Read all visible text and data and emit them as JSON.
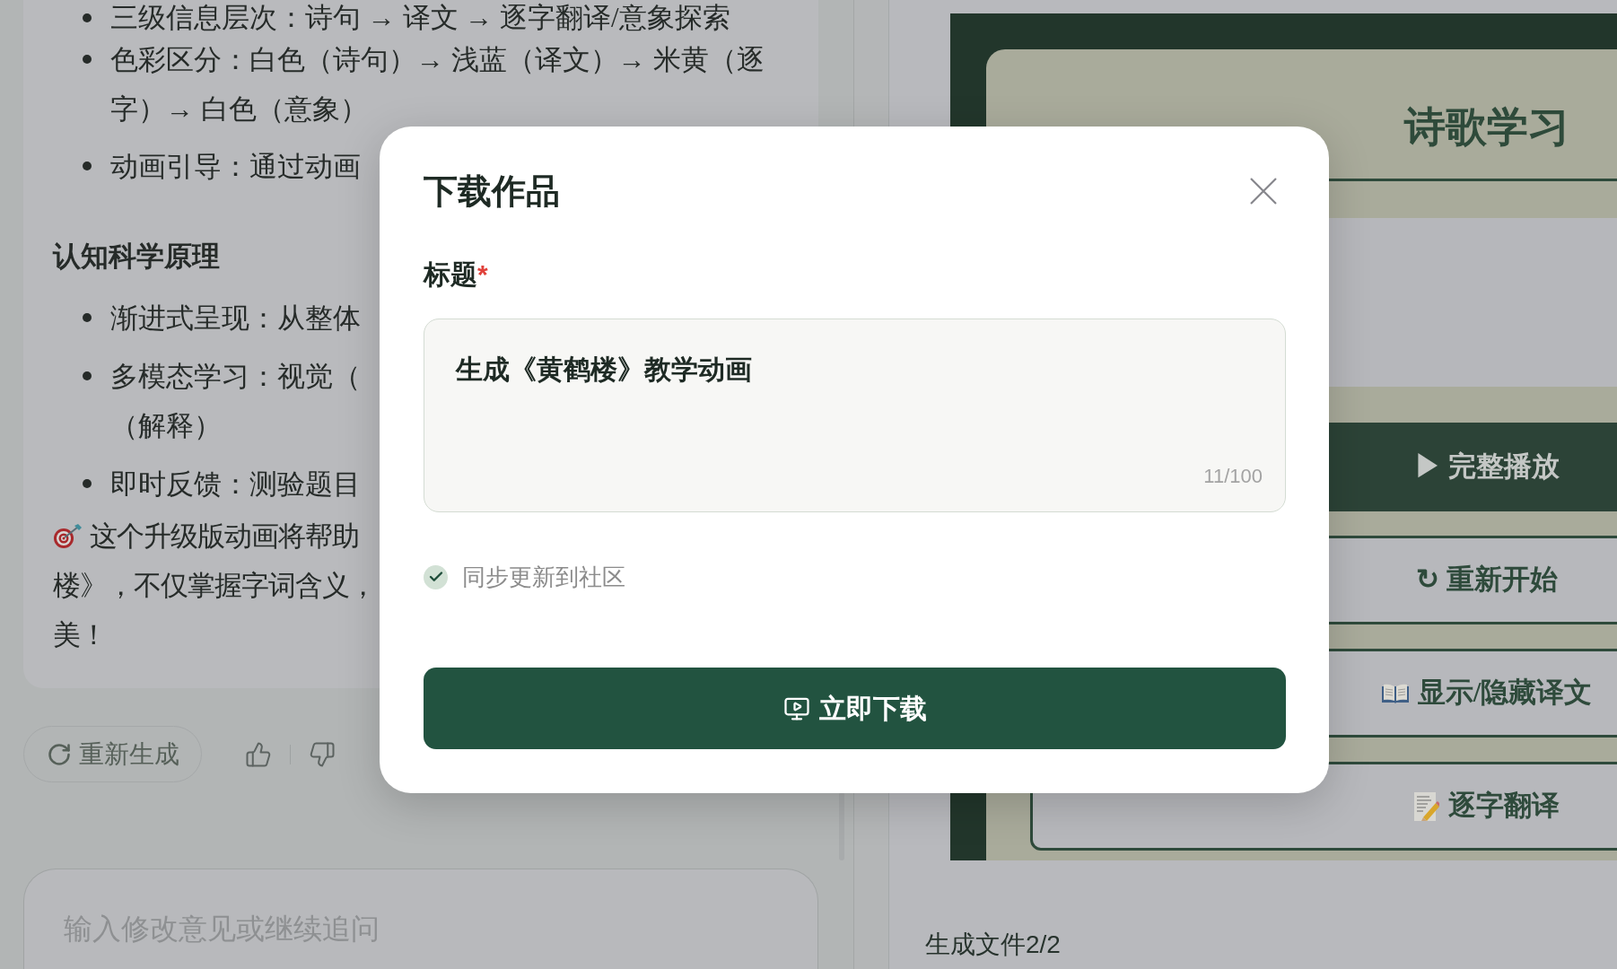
{
  "chat": {
    "message": {
      "list_1": [
        {
          "lines": [
            "三级信息层次：诗句 → 译文 → 逐字翻译/意象探索"
          ]
        },
        {
          "lines": [
            "色彩区分：白色（诗句）→ 浅蓝（译文）→ 米黄（逐",
            "字）→ 白色（意象）"
          ]
        },
        {
          "lines": [
            "动画引导：通过动画"
          ]
        }
      ],
      "heading": "认知科学原理",
      "list_2": [
        {
          "lines": [
            "渐进式呈现：从整体"
          ]
        },
        {
          "lines": [
            "多模态学习：视觉（",
            "（解释）"
          ]
        },
        {
          "lines": [
            "即时反馈：测验题目"
          ]
        }
      ],
      "closing": {
        "lines": [
          "这个升级版动画将帮助",
          "楼》，不仅掌握字词含义，",
          "美！"
        ]
      }
    },
    "regenerate": "重新生成",
    "input": {
      "placeholder": "输入修改意见或继续追问"
    }
  },
  "preview": {
    "title": "诗歌学习",
    "buttons": [
      {
        "label": "▶ 完整播放",
        "kind": "filled"
      },
      {
        "label": "↻ 重新开始",
        "kind": "outlined"
      },
      {
        "label": "显示/隐藏译文",
        "kind": "book"
      },
      {
        "label": "逐字翻译",
        "kind": "memo"
      }
    ],
    "file_status": "生成文件2/2"
  },
  "dialog": {
    "title": "下载作品",
    "field": {
      "label": "标题",
      "required_mark": "*",
      "value": "生成《黄鹤楼》教学动画",
      "counter": "11/100"
    },
    "sync": {
      "label": "同步更新到社区",
      "checked": true
    },
    "submit": "立即下载"
  }
}
